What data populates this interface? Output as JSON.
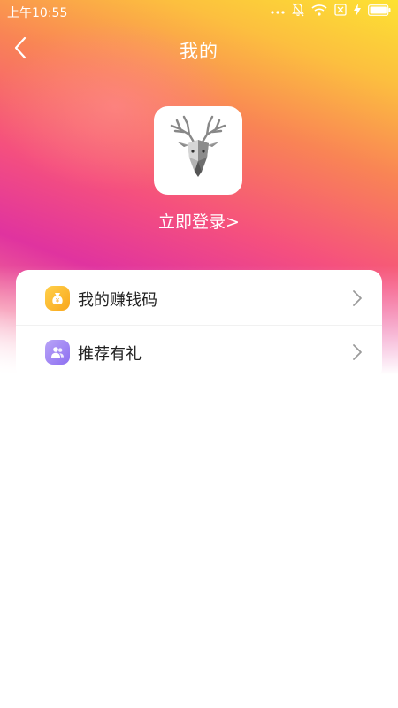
{
  "status_bar": {
    "time": "上午10:55",
    "icons": [
      "more-dots-icon",
      "mute-bell-icon",
      "wifi-icon",
      "no-sim-icon",
      "charging-icon",
      "battery-icon"
    ]
  },
  "header": {
    "title": "我的",
    "back_icon": "chevron-left-icon"
  },
  "profile": {
    "avatar_icon": "deer-head-logo",
    "login_label": "立即登录>"
  },
  "menu": {
    "items": [
      {
        "label": "我的赚钱码",
        "icon": "money-bag-icon",
        "icon_color": "#F9B12B"
      },
      {
        "label": "推荐有礼",
        "icon": "people-icon",
        "icon_color": "#9C82F3"
      }
    ]
  },
  "colors": {
    "gradient_top": "#FDE232",
    "gradient_mid": "#F5507E",
    "gradient_deep": "#E0339F",
    "text_primary": "#222222",
    "chevron": "#9A9A9A"
  }
}
